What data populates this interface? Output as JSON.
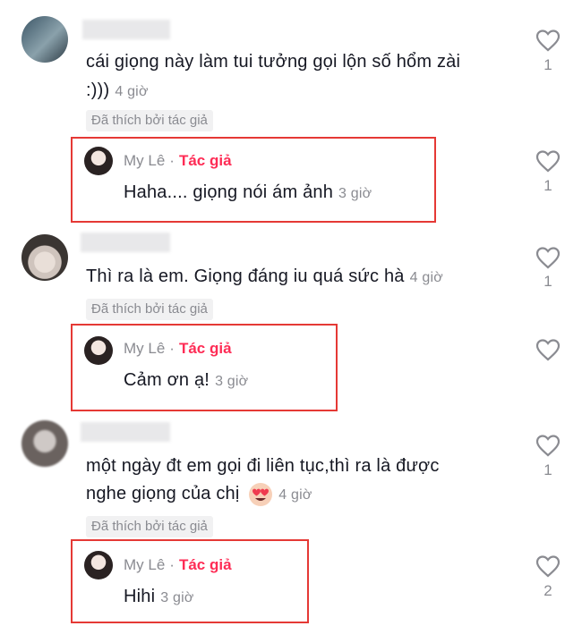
{
  "comments": [
    {
      "text_line1": "cái giọng này làm tui tưởng gọi lộn số hổm zài",
      "text_line2": ":)))",
      "time": "4 giờ",
      "liked_badge": "Đã thích bởi tác giả",
      "likes": "1",
      "reply": {
        "name": "My Lê",
        "dot": "·",
        "author_tag": "Tác giả",
        "text": "Haha.... giọng nói ám ảnh",
        "time": "3 giờ",
        "likes": "1"
      }
    },
    {
      "text_line1": "Thì ra là em. Giọng đáng iu quá sức hà",
      "time": "4 giờ",
      "liked_badge": "Đã thích bởi tác giả",
      "likes": "1",
      "reply": {
        "name": "My Lê",
        "dot": "·",
        "author_tag": "Tác giả",
        "text": "Cảm ơn ạ!",
        "time": "3 giờ",
        "likes": ""
      }
    },
    {
      "text_line1": "một ngày đt em gọi đi liên tục,thì ra là được",
      "text_line2": "nghe giọng của chị",
      "emoji": "heart-eyes-emoji",
      "time": "4 giờ",
      "liked_badge": "Đã thích bởi tác giả",
      "likes": "1",
      "reply": {
        "name": "My Lê",
        "dot": "·",
        "author_tag": "Tác giả",
        "text": "Hihi",
        "time": "3 giờ",
        "likes": "2"
      }
    }
  ],
  "colors": {
    "author_tag": "#fe2c55",
    "highlight_box": "#e53935",
    "secondary_text": "#8a8b91",
    "badge_bg": "#f1f1f2"
  },
  "icons": {
    "like": "heart-outline-icon"
  }
}
